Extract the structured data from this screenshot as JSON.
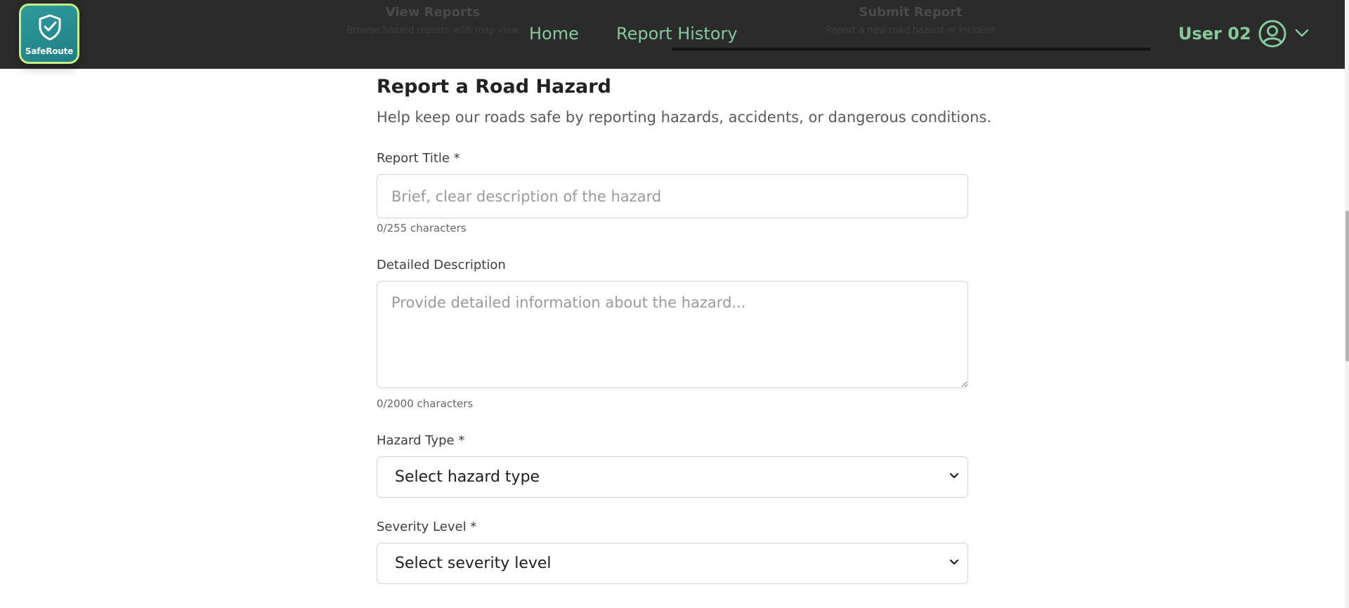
{
  "app": {
    "logo_text": "SafeRoute"
  },
  "header": {
    "behind_tabs": [
      {
        "title": "View Reports",
        "subtitle": "Browse hazard reports with map view"
      },
      {
        "title": "Submit Report",
        "subtitle": "Report a new road hazard or incident"
      }
    ],
    "nav": {
      "home": "Home",
      "history": "Report History"
    },
    "user": {
      "name": "User 02"
    }
  },
  "form": {
    "title": "Report a Road Hazard",
    "subtitle": "Help keep our roads safe by reporting hazards, accidents, or dangerous conditions.",
    "report_title": {
      "label": "Report Title *",
      "placeholder": "Brief, clear description of the hazard",
      "value": "",
      "counter": "0/255 characters"
    },
    "description": {
      "label": "Detailed Description",
      "placeholder": "Provide detailed information about the hazard...",
      "value": "",
      "counter": "0/2000 characters"
    },
    "hazard_type": {
      "label": "Hazard Type *",
      "selected": "Select hazard type"
    },
    "severity": {
      "label": "Severity Level *",
      "selected": "Select severity level"
    }
  },
  "colors": {
    "header_bg": "#2b2b2b",
    "accent": "#86c99a",
    "logo_bg": "#1f7f86",
    "logo_border": "#c6ee82"
  },
  "icons": {
    "logo": "shield-check-icon",
    "user": "user-circle-icon",
    "dropdown": "chevron-down-icon",
    "select_caret": "chevron-down-icon"
  }
}
